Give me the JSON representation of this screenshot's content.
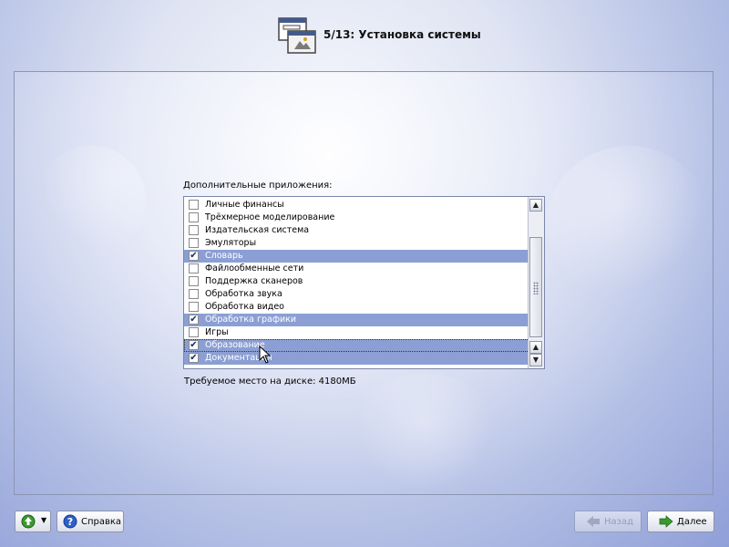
{
  "header": {
    "title": "5/13: Установка системы",
    "icon": "installer-icon"
  },
  "section_label": "Дополнительные приложения:",
  "packages": [
    {
      "label": "Личные финансы",
      "checked": false
    },
    {
      "label": "Трёхмерное моделирование",
      "checked": false
    },
    {
      "label": "Издательская система",
      "checked": false
    },
    {
      "label": "Эмуляторы",
      "checked": false
    },
    {
      "label": "Словарь",
      "checked": true
    },
    {
      "label": "Файлообменные сети",
      "checked": false
    },
    {
      "label": "Поддержка сканеров",
      "checked": false
    },
    {
      "label": "Обработка звука",
      "checked": false
    },
    {
      "label": "Обработка видео",
      "checked": false
    },
    {
      "label": "Обработка графики",
      "checked": true
    },
    {
      "label": "Игры",
      "checked": false
    },
    {
      "label": "Образование",
      "checked": true
    },
    {
      "label": "Документация",
      "checked": true
    }
  ],
  "checkmark": "✔",
  "disk_space": "Требуемое место на диске: 4180МБ",
  "buttons": {
    "help": "Справка",
    "back": "Назад",
    "next": "Далее"
  },
  "colors": {
    "selection": "#8b9fd4",
    "accent_green": "#3b9a2f"
  }
}
